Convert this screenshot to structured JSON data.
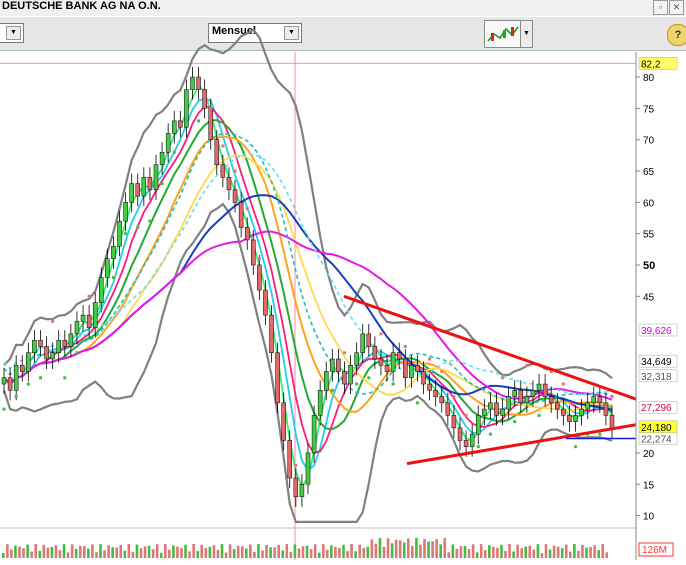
{
  "window": {
    "title": "DEUTSCHE BANK AG NA O.N.",
    "close_icon": "close-icon",
    "restore_icon": "restore-icon"
  },
  "toolbar": {
    "left_combo_arrow": "chevron-down-icon",
    "period_select": {
      "value": "Mensuel"
    },
    "chart_tool_icon": "candlestick-chart-icon",
    "help_icon": "help-icon"
  },
  "chart_data": {
    "type": "candlestick",
    "title": "",
    "xlabel": "",
    "ylabel": "",
    "ylim": [
      8.5,
      84
    ],
    "y_ticks": [
      {
        "value": 80,
        "label": "80"
      },
      {
        "value": 75,
        "label": "75"
      },
      {
        "value": 70,
        "label": "70"
      },
      {
        "value": 65,
        "label": "65"
      },
      {
        "value": 60,
        "label": "60"
      },
      {
        "value": 55,
        "label": "55"
      },
      {
        "value": 50,
        "label": "50"
      },
      {
        "value": 45,
        "label": "45"
      },
      {
        "value": 20,
        "label": "20"
      },
      {
        "value": 15,
        "label": "15"
      },
      {
        "value": 10,
        "label": "10"
      }
    ],
    "price_badges": [
      {
        "label": "82,2",
        "value": 82.2,
        "color": "#ffff66",
        "text": "#000000"
      },
      {
        "label": "39,626",
        "value": 39.626,
        "color": "#ffffff",
        "text": "#d100d1"
      },
      {
        "label": "34,649",
        "value": 34.649,
        "color": "#ffffff",
        "text": "#000000"
      },
      {
        "label": "32,318",
        "value": 32.318,
        "color": "#ffffff",
        "text": "#555555"
      },
      {
        "label": "27,296",
        "value": 27.296,
        "color": "#ffffff",
        "text": "#e0005a"
      },
      {
        "label": "24,180",
        "value": 24.18,
        "color": "#ffff33",
        "text": "#000000"
      },
      {
        "label": "22,274",
        "value": 22.274,
        "color": "#ffffff",
        "text": "#555555"
      }
    ],
    "volume_badge": {
      "label": "126M",
      "color": "#ff3333"
    },
    "closes": [
      32,
      30,
      34,
      33,
      36,
      38,
      37,
      35,
      36,
      38,
      37,
      39,
      41,
      42,
      40,
      44,
      48,
      51,
      53,
      57,
      60,
      63,
      61,
      64,
      62,
      66,
      68,
      71,
      73,
      72,
      78,
      80,
      78,
      75,
      70,
      66,
      64,
      62,
      60,
      56,
      54,
      50,
      46,
      42,
      36,
      28,
      22,
      16,
      13,
      15,
      20,
      26,
      30,
      33,
      35,
      33,
      31,
      34,
      36,
      39,
      37,
      35,
      34,
      33,
      36,
      35,
      32,
      34,
      33,
      31,
      30,
      29,
      28,
      26,
      24,
      22,
      21,
      23,
      26,
      27,
      28,
      26,
      27,
      29,
      30,
      28,
      29,
      30,
      31,
      29,
      28,
      27,
      26,
      25,
      26,
      27,
      28,
      29,
      28,
      26,
      24
    ],
    "series": [
      {
        "name": "",
        "color": "#ff2222",
        "values": []
      },
      {
        "name": "",
        "color": "#00cc00",
        "values": []
      }
    ],
    "trendlines": [
      {
        "kind": "resistance",
        "from": [
          344,
          45.0
        ],
        "to": [
          636,
          28.6
        ],
        "color": "#ee1111"
      },
      {
        "kind": "support",
        "from": [
          407,
          18.3
        ],
        "to": [
          636,
          24.5
        ],
        "color": "#ee1111"
      },
      {
        "kind": "horizontal",
        "from": [
          566,
          22.3
        ],
        "to": [
          636,
          22.3
        ],
        "color": "#1a1acc"
      }
    ]
  }
}
